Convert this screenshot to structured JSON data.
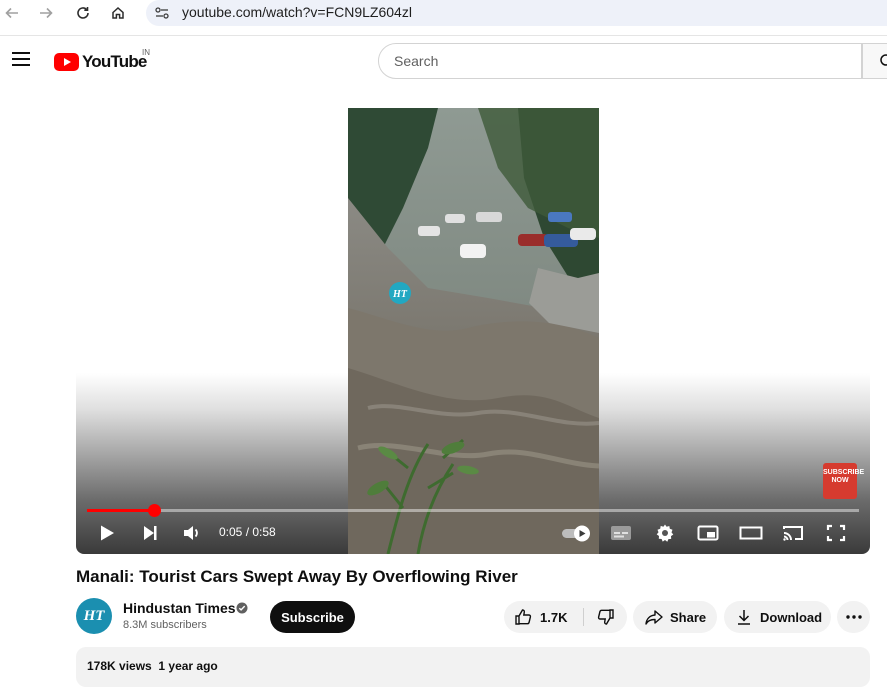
{
  "browser": {
    "url": "youtube.com/watch?v=FCN9LZ604zl"
  },
  "header": {
    "logo_text": "YouTube",
    "region": "IN",
    "search_placeholder": "Search"
  },
  "player": {
    "watermark": "HT",
    "badge_text": "SUBSCRIBE NOW",
    "time": "0:05 / 0:58",
    "progress_fraction": 0.087,
    "accent_color": "#ff0000"
  },
  "video": {
    "title": "Manali: Tourist Cars Swept Away By Overflowing River",
    "channel_name": "Hindustan Times",
    "avatar_text": "HT",
    "subscribers": "8.3M subscribers",
    "subscribe_label": "Subscribe",
    "likes": "1.7K",
    "share_label": "Share",
    "download_label": "Download",
    "views": "178K views",
    "published": "1 year ago"
  }
}
